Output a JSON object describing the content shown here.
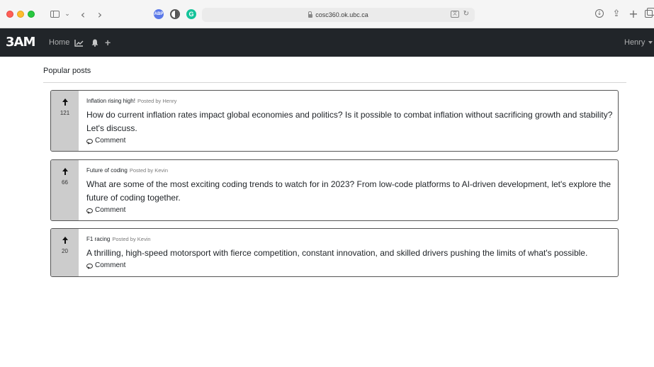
{
  "browser": {
    "url": "cosc360.ok.ubc.ca",
    "icons": [
      "sidebar-icon",
      "chevron-down-icon",
      "back-arrow-icon",
      "forward-arrow-icon",
      "adblock-icon",
      "privacy-icon",
      "grammarly-icon",
      "lock-icon",
      "translate-icon",
      "reload-icon",
      "download-icon",
      "share-icon",
      "plus-icon",
      "tabs-icon"
    ],
    "extensions": {
      "abp": "ABP",
      "grammarly": "G"
    },
    "back": "‹",
    "forward": "›",
    "chevron": "⌄",
    "new_tab": "+",
    "share": "⇪",
    "download": "↓",
    "translate": "文",
    "reload": "↻"
  },
  "navbar": {
    "brand": "3AM",
    "links": {
      "home": "Home",
      "trending": "⟋",
      "bell": "▲",
      "plus": "+"
    },
    "user": "Henry",
    "colors": {
      "bg": "#212529",
      "text": "#ffffff"
    }
  },
  "main": {
    "section_title": "Popular posts",
    "posts": [
      {
        "title": "Inflation rising high!",
        "posted_by": "Posted by Henry",
        "votes": "121",
        "body": "How do current inflation rates impact global economies and politics? Is it possible to combat inflation without sacrificing growth and stability? Let's discuss.",
        "comment_label": "Comment"
      },
      {
        "title": "Future of coding",
        "posted_by": "Posted by Kevin",
        "votes": "66",
        "body": "What are some of the most exciting coding trends to watch for in 2023? From low-code platforms to AI-driven development, let's explore the future of coding together.",
        "comment_label": "Comment"
      },
      {
        "title": "F1 racing",
        "posted_by": "Posted by Kevin",
        "votes": "20",
        "body": "A thrilling, high-speed motorsport with fierce competition, constant innovation, and skilled drivers pushing the limits of what's possible.",
        "comment_label": "Comment"
      }
    ]
  }
}
